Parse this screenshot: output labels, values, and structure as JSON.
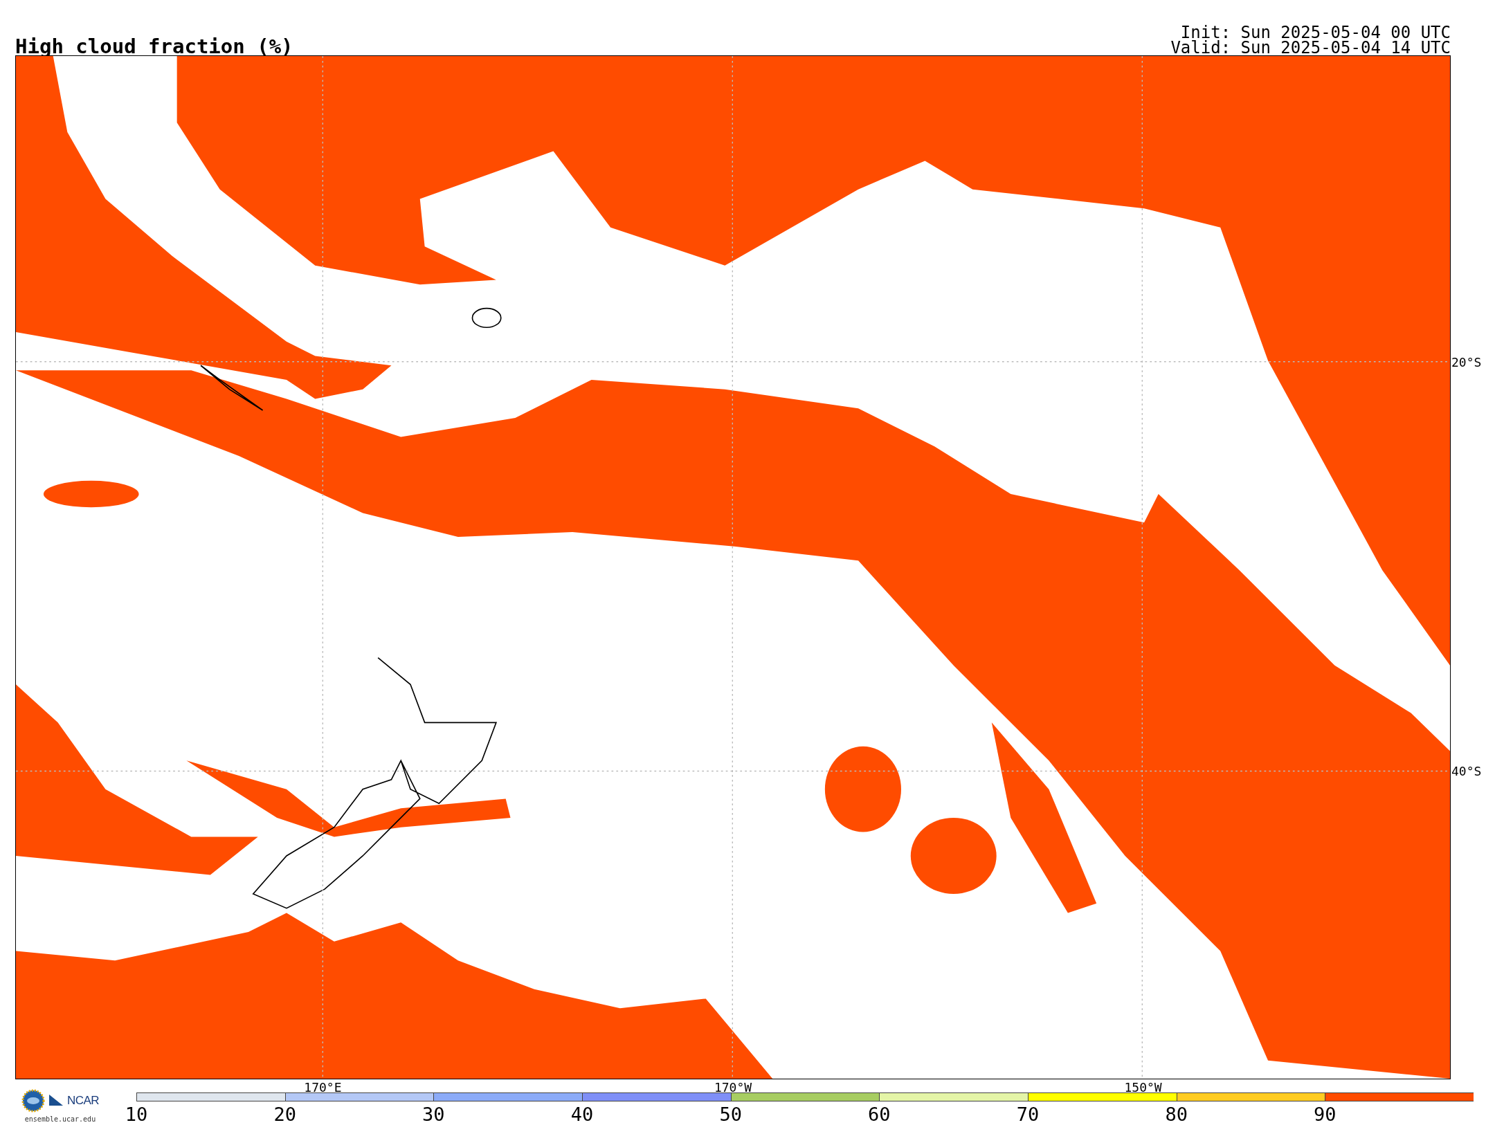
{
  "title": "High cloud fraction (%)",
  "init": "Init: Sun 2025-05-04 00 UTC",
  "valid": "Valid: Sun 2025-05-04 14 UTC",
  "map": {
    "lon_labels": [
      "170°E",
      "170°W",
      "150°W"
    ],
    "lat_labels": [
      "20°S",
      "40°S"
    ]
  },
  "logo": {
    "name": "NCAR",
    "url": "ensemble.ucar.edu"
  },
  "colorbar": {
    "bins": [
      {
        "label": "10",
        "color": "#dfe6ee"
      },
      {
        "label": "20",
        "color": "#b4c8f6"
      },
      {
        "label": "30",
        "color": "#8cabf8"
      },
      {
        "label": "40",
        "color": "#7f8ff7"
      },
      {
        "label": "50",
        "color": "#a7cd62"
      },
      {
        "label": "60",
        "color": "#e4f5a7"
      },
      {
        "label": "70",
        "color": "#ffff00"
      },
      {
        "label": "80",
        "color": "#ffcc22"
      },
      {
        "label": "90",
        "color": "#ff4c00"
      }
    ]
  }
}
